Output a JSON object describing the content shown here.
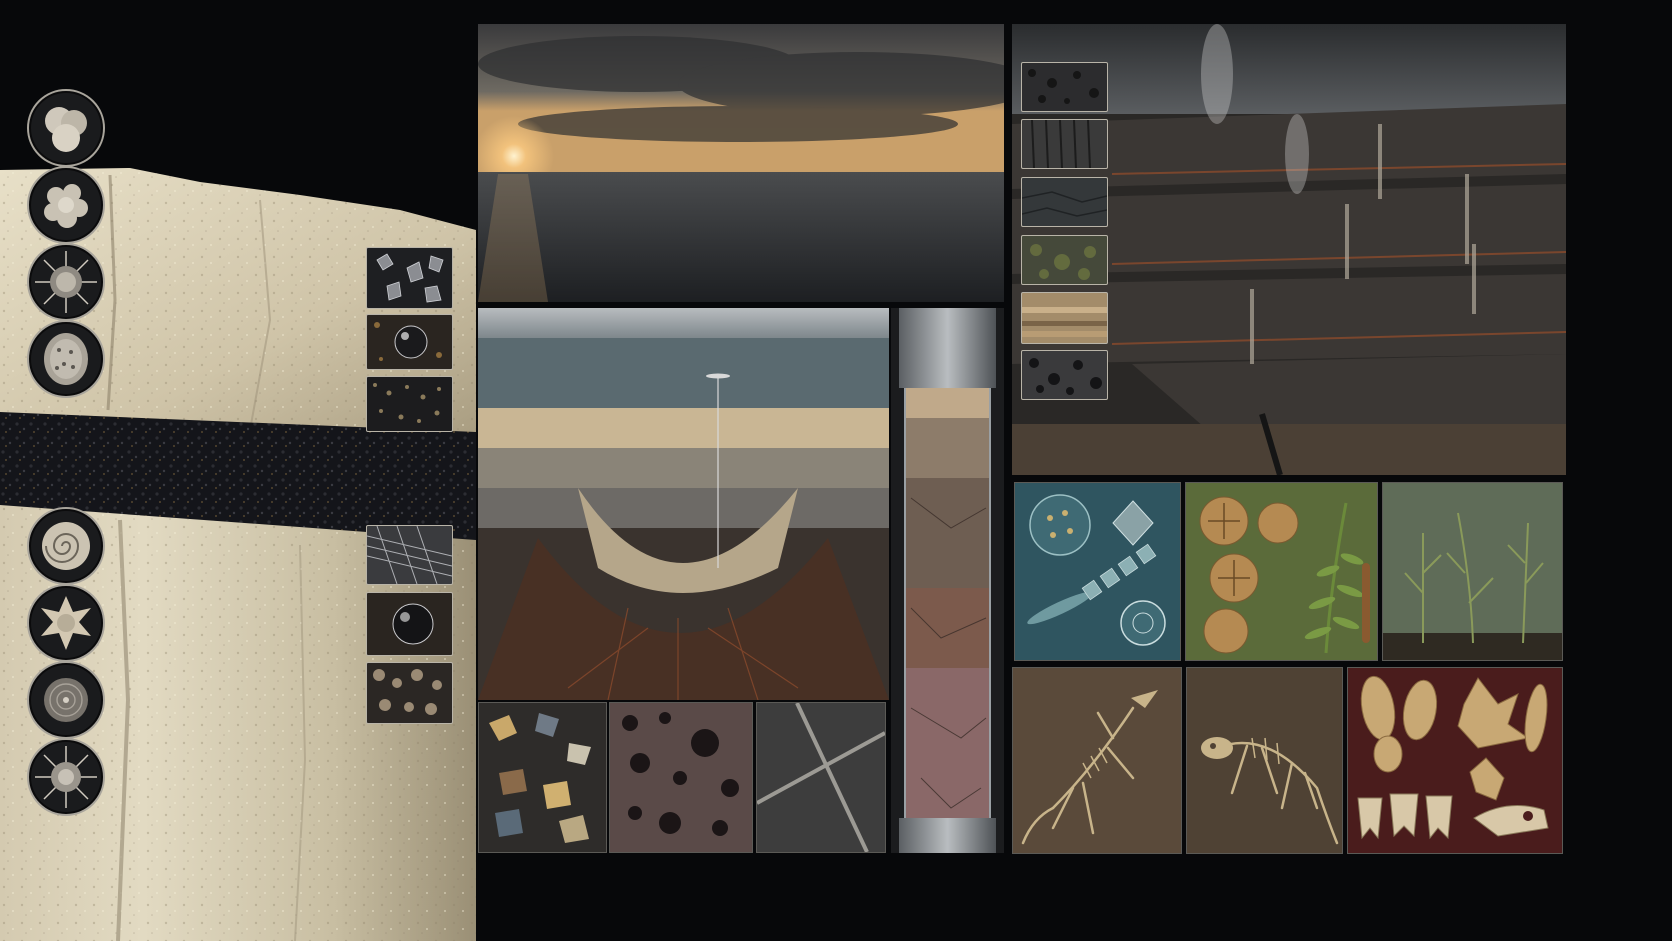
{
  "scene": {
    "kind": "geology-collage",
    "palette": {
      "background": "#07080a",
      "chalk": "#d8cfb8",
      "coal_band": "#15161a",
      "sea_dark": "#2b2f33",
      "sunset": "#e0b070",
      "rust": "#8a4a2c",
      "fossil_bone": "#c8b48a",
      "diatom_teal": "#2f5560",
      "fern_green": "#5b6b3a",
      "leaf_maroon": "#4a1c1c"
    }
  },
  "left_block": {
    "microfossil_icons_top": [
      "foraminifera-icon",
      "foraminifera-cluster-icon",
      "radiolarian-icon",
      "coccolith-icon"
    ],
    "microfossil_icons_bottom": [
      "ammonite-spiral-icon",
      "spiky-pollen-icon",
      "ridged-sphere-icon",
      "radiolarian-icon"
    ],
    "mineral_swatches_top": [
      "crystal-fragments",
      "glass-bead",
      "granular-grit"
    ],
    "mineral_swatches_bottom": [
      "crosshatched-fibers",
      "glass-bead",
      "pebble-grains"
    ]
  },
  "center": {
    "top_panel": "sunset-over-sea",
    "cross_section": "excavated-strata-cross-section",
    "core_sample": "drill-core-tube",
    "bottom_tiles": [
      "mottled-breccia",
      "pitted-vesicular-rock",
      "jointed-slate"
    ]
  },
  "right": {
    "top_panel": "steaming-stepped-quarry",
    "side_swatches": [
      "dark-scoria",
      "columnar-bark",
      "dark-rock",
      "mossy-stone",
      "layered-sandstone",
      "vesicular-basalt"
    ],
    "fossil_tiles_row1": [
      "diatoms-and-radiolaria",
      "sand-dollars-and-fern",
      "ancient-plant-sprigs"
    ],
    "fossil_tiles_row2": [
      "bird-skeleton-fossil",
      "reptile-skeleton-fossil",
      "leaves-teeth-and-skull"
    ]
  }
}
